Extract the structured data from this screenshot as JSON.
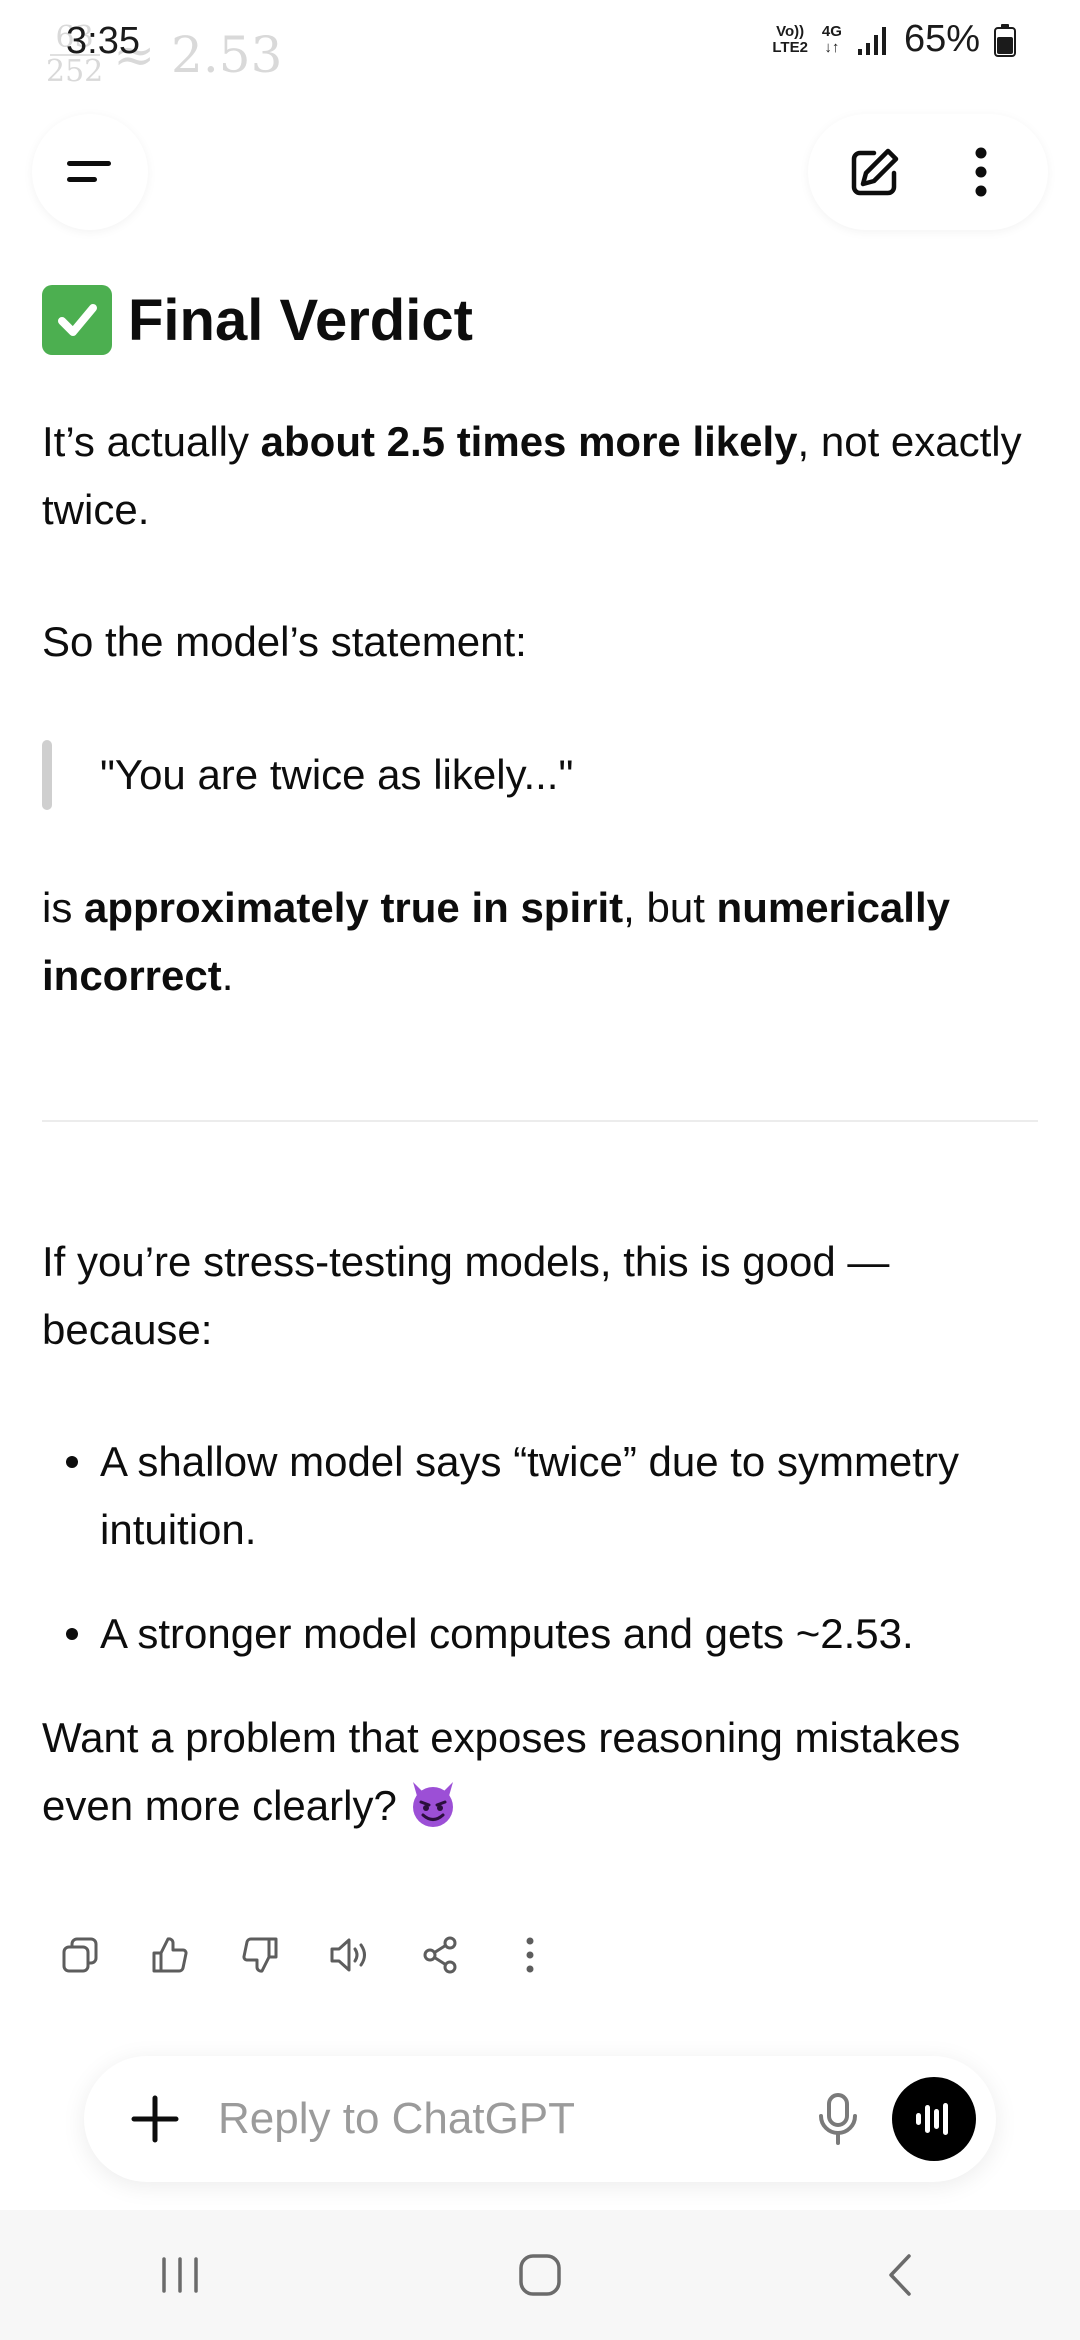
{
  "status_bar": {
    "time": "3:35",
    "ghost_fraction_top": "63",
    "ghost_fraction_bottom": "252",
    "ghost_approx": "≈ 2.53",
    "network_volte": "Vo))",
    "network_lte": "LTE2",
    "network_4g": "4G",
    "battery": "65%"
  },
  "top_bar": {
    "menu_icon": "menu-icon",
    "new_chat_icon": "edit-icon",
    "more_icon": "more-vertical-icon"
  },
  "message": {
    "heading_emoji": "check-mark-button-icon",
    "heading": "Final Verdict",
    "p1_a": "It’s actually ",
    "p1_b": "about 2.5 times more likely",
    "p1_c": ", not exactly twice.",
    "p2": "So the model’s statement:",
    "quote": "\"You are twice as likely...\"",
    "p3_a": "is ",
    "p3_b": "approximately true in spirit",
    "p3_c": ", but ",
    "p3_d": "numerically incorrect",
    "p3_e": ".",
    "p4": "If you’re stress-testing models, this is good — because:",
    "bullets": [
      "A shallow model says “twice” due to symmetry intuition.",
      "A stronger model computes and gets ~2.53."
    ],
    "p5": "Want a problem that exposes reasoning mistakes even more clearly?",
    "p5_emoji": "smiling-devil-icon"
  },
  "message_actions": [
    "copy-icon",
    "thumbs-up-icon",
    "thumbs-down-icon",
    "read-aloud-icon",
    "share-icon",
    "more-vertical-icon"
  ],
  "composer": {
    "placeholder": "Reply to ChatGPT",
    "value": ""
  },
  "nav_bar": [
    "recent-apps-icon",
    "home-icon",
    "back-icon"
  ],
  "colors": {
    "text": "#0d0d0d",
    "placeholder": "#9b9b9b",
    "check_green": "#4caf50",
    "devil_purple": "#9c4fd6"
  }
}
